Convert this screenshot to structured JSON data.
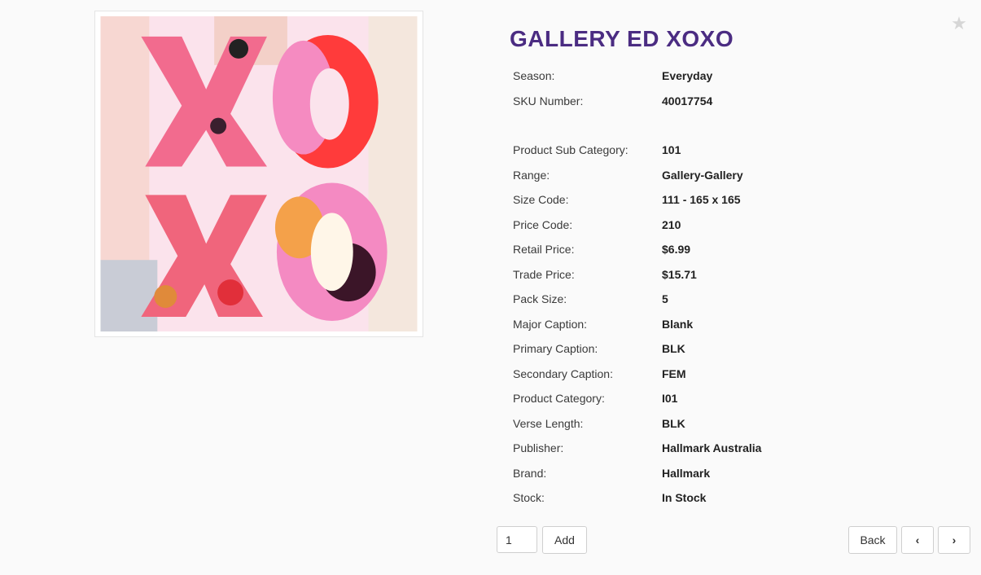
{
  "product": {
    "title": "GALLERY ED XOXO",
    "image_alt": "XOXO card artwork",
    "favorite_icon": "star-icon",
    "details_group1": [
      {
        "label": "Season:",
        "value": "Everyday"
      },
      {
        "label": "SKU Number:",
        "value": "40017754"
      }
    ],
    "details_group2": [
      {
        "label": "Product Sub Category:",
        "value": "101"
      },
      {
        "label": "Range:",
        "value": "Gallery-Gallery"
      },
      {
        "label": "Size Code:",
        "value": "111 - 165 x 165"
      },
      {
        "label": "Price Code:",
        "value": "210"
      },
      {
        "label": "Retail Price:",
        "value": "$6.99"
      },
      {
        "label": "Trade Price:",
        "value": "$15.71"
      },
      {
        "label": "Pack Size:",
        "value": "5"
      },
      {
        "label": "Major Caption:",
        "value": "Blank"
      },
      {
        "label": "Primary Caption:",
        "value": "BLK"
      },
      {
        "label": "Secondary Caption:",
        "value": "FEM"
      },
      {
        "label": "Product Category:",
        "value": "I01"
      },
      {
        "label": "Verse Length:",
        "value": "BLK"
      },
      {
        "label": "Publisher:",
        "value": "Hallmark Australia"
      },
      {
        "label": "Brand:",
        "value": "Hallmark"
      },
      {
        "label": "Stock:",
        "value": "In Stock"
      }
    ]
  },
  "actions": {
    "quantity_value": "1",
    "add_label": "Add",
    "back_label": "Back",
    "prev_icon": "chevron-left-icon",
    "prev_glyph": "‹",
    "next_icon": "chevron-right-icon",
    "next_glyph": "›"
  },
  "colors": {
    "title": "#4b2c82",
    "star": "#d6d6d6"
  }
}
